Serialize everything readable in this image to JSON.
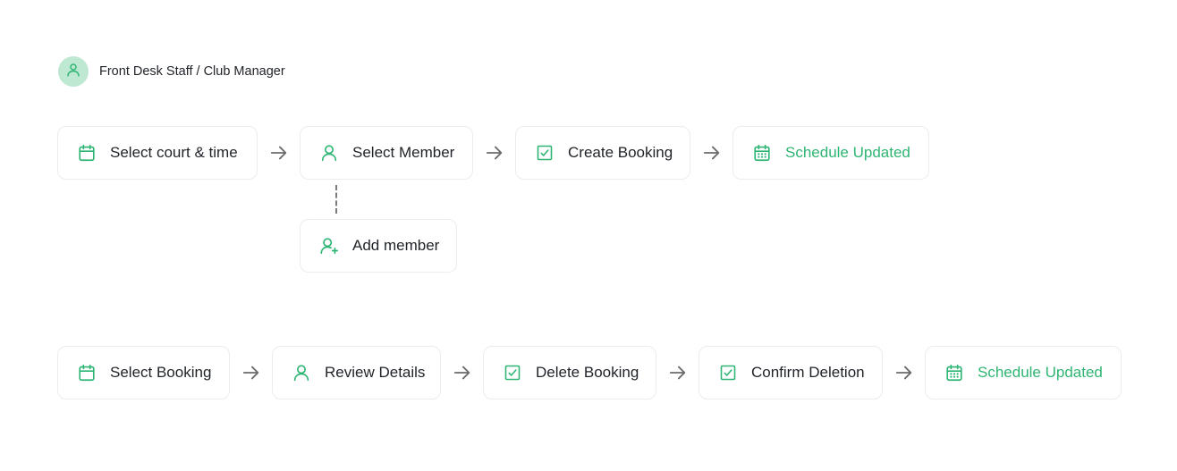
{
  "colors": {
    "accent": "#2fb573",
    "avatar_bg": "#bfe8d2",
    "border": "#ececec",
    "arrow": "#6b6b6b"
  },
  "role": {
    "label": "Front Desk Staff / Club Manager",
    "icon": "user-icon"
  },
  "flow_1": {
    "steps": [
      {
        "label": "Select court & time",
        "icon": "calendar-icon"
      },
      {
        "label": "Select Member",
        "icon": "user-icon"
      },
      {
        "label": "Create Booking",
        "icon": "checkbox-icon"
      },
      {
        "label": "Schedule Updated",
        "icon": "calendar-grid-icon"
      }
    ],
    "branch": {
      "label": "Add member",
      "icon": "user-plus-icon"
    }
  },
  "flow_2": {
    "steps": [
      {
        "label": "Select Booking",
        "icon": "calendar-icon"
      },
      {
        "label": "Review Details",
        "icon": "user-icon"
      },
      {
        "label": "Delete Booking",
        "icon": "checkbox-icon"
      },
      {
        "label": "Confirm Deletion",
        "icon": "checkbox-icon"
      },
      {
        "label": "Schedule Updated",
        "icon": "calendar-grid-icon"
      }
    ]
  }
}
